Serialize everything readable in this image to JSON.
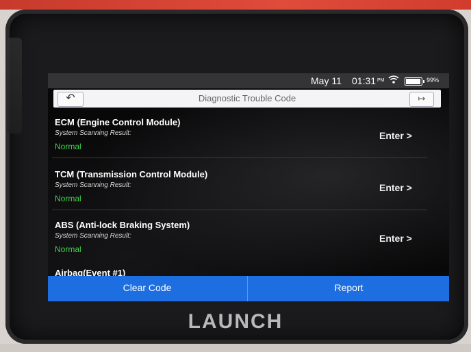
{
  "status_bar": {
    "date": "May 11",
    "time": "01:31",
    "ampm": "PM",
    "battery": "99%"
  },
  "header": {
    "title": "Diagnostic Trouble Code",
    "back_glyph": "↶",
    "exit_glyph": "↦"
  },
  "modules": [
    {
      "name": "ECM (Engine Control Module)",
      "label": "System Scanning Result:",
      "status": "Normal",
      "action": "Enter >"
    },
    {
      "name": "TCM (Transmission Control Module)",
      "label": "System Scanning Result:",
      "status": "Normal",
      "action": "Enter >"
    },
    {
      "name": "ABS (Anti-lock Braking System)",
      "label": "System Scanning Result:",
      "status": "Normal",
      "action": "Enter >"
    },
    {
      "name": "Airbag(Event #1)"
    }
  ],
  "actions": {
    "clear_code": "Clear Code",
    "report": "Report"
  },
  "device": {
    "brand": "LAUNCH"
  },
  "colors": {
    "accent_blue": "#1d6ee0",
    "status_green": "#3ed24a",
    "status_bar": "#343437"
  },
  "icons": {
    "wifi": "wifi-icon",
    "battery": "battery-icon",
    "back": "back-arrow-icon",
    "exit": "exit-icon"
  }
}
